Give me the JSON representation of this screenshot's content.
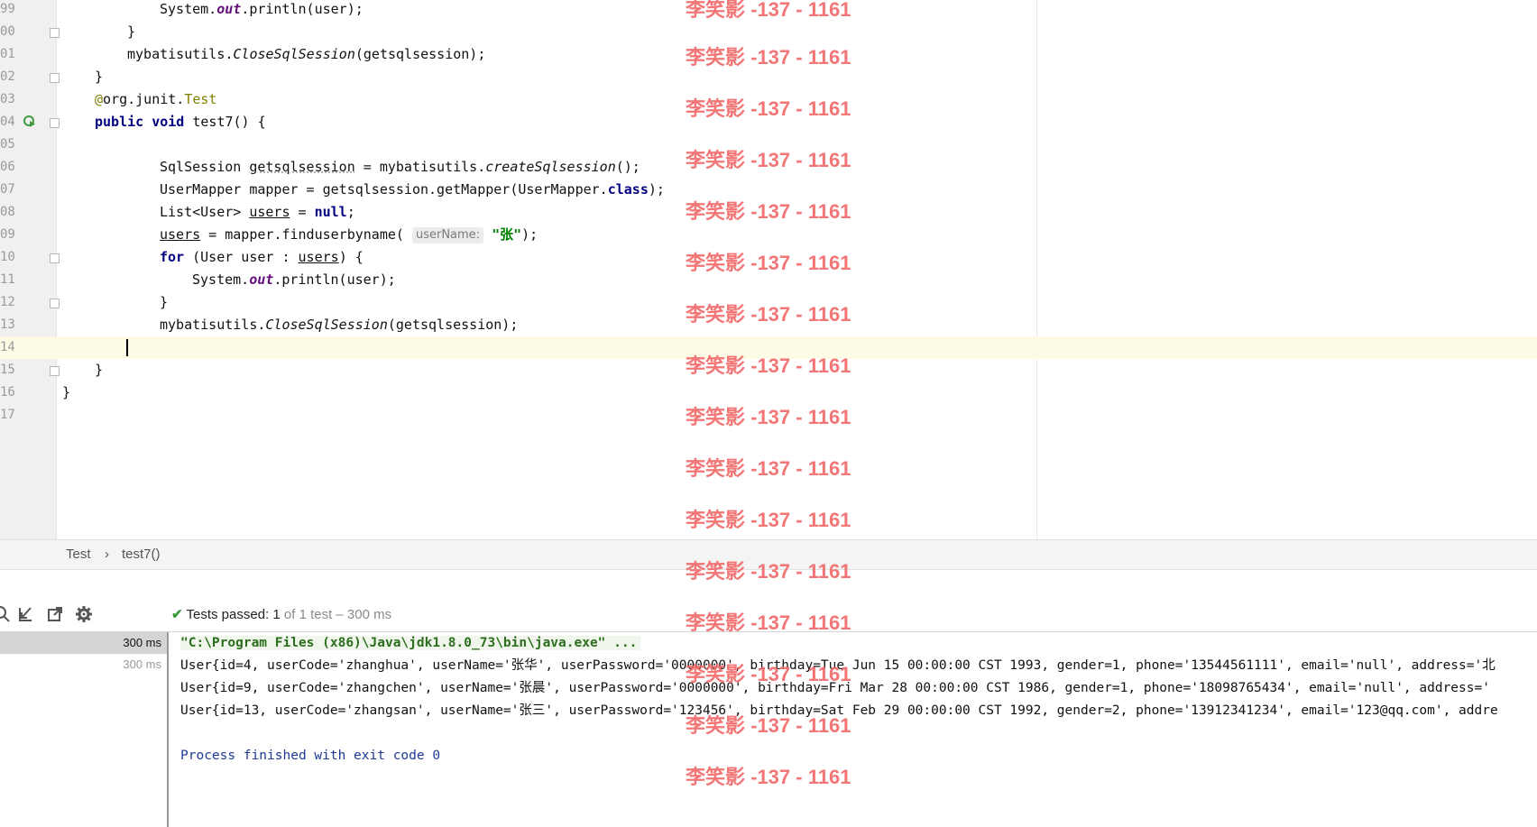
{
  "editor": {
    "lines": [
      {
        "num": "99",
        "html_key": "l99"
      },
      {
        "num": "00",
        "html_key": "l100"
      },
      {
        "num": "01",
        "html_key": "l101"
      },
      {
        "num": "02",
        "html_key": "l102"
      },
      {
        "num": "03",
        "html_key": "l103"
      },
      {
        "num": "04",
        "html_key": "l104"
      },
      {
        "num": "05",
        "html_key": "l105"
      },
      {
        "num": "06",
        "html_key": "l106"
      },
      {
        "num": "07",
        "html_key": "l107"
      },
      {
        "num": "08",
        "html_key": "l108"
      },
      {
        "num": "09",
        "html_key": "l109"
      },
      {
        "num": "10",
        "html_key": "l110"
      },
      {
        "num": "11",
        "html_key": "l111"
      },
      {
        "num": "12",
        "html_key": "l112"
      },
      {
        "num": "13",
        "html_key": "l113"
      },
      {
        "num": "14",
        "html_key": "l114"
      },
      {
        "num": "15",
        "html_key": "l115"
      },
      {
        "num": "16",
        "html_key": "l116"
      },
      {
        "num": "17",
        "html_key": "l117"
      }
    ],
    "tokens": {
      "system": "System.",
      "out": "out",
      "println_user": ".println(user);",
      "close_brace": "}",
      "mybatisutils": "mybatisutils.",
      "close_sql": "CloseSqlSession",
      "close_arg": "(getsqlsession);",
      "at": "@",
      "org_junit": "org.junit.",
      "test_ann": "Test",
      "public": "public",
      "void": "void",
      "test7": "test7() {",
      "sqlsession": "SqlSession ",
      "getsqlsession": "getsqlsession",
      "eq_mybatis": " = mybatisutils.",
      "create_sql": "createSqlsession",
      "create_end": "();",
      "usermapper_line": "UserMapper mapper = getsqlsession.getMapper(UserMapper.",
      "class_kw": "class",
      "close_paren": ");",
      "list_user": "List<User> ",
      "users": "users",
      "eq": " = ",
      "null_kw": "null",
      "semicolon": ";",
      "finduser": " = mapper.finduserbyname(",
      "hint": "userName:",
      "zhang": "\"张\"",
      "for_kw": "for",
      "for_head": " (User user : ",
      "for_tail": ") {",
      "system2": "System.",
      "println2": ".println(user);"
    }
  },
  "breadcrumb": {
    "class_name": "Test",
    "separator": "›",
    "method": "test7()"
  },
  "run": {
    "status_label": "Tests passed:",
    "status_count": "1",
    "status_rest": "of 1 test – 300 ms",
    "tree": [
      {
        "label": "300 ms",
        "selected": true
      },
      {
        "label": "300 ms",
        "selected": false
      }
    ],
    "console": {
      "cmd": "\"C:\\Program Files (x86)\\Java\\jdk1.8.0_73\\bin\\java.exe\" ...",
      "rows": [
        "User{id=4, userCode='zhanghua', userName='张华', userPassword='0000000', birthday=Tue Jun 15 00:00:00 CST 1993, gender=1, phone='13544561111', email='null', address='北",
        "User{id=9, userCode='zhangchen', userName='张晨', userPassword='0000000', birthday=Fri Mar 28 00:00:00 CST 1986, gender=1, phone='18098765434', email='null', address='",
        "User{id=13, userCode='zhangsan', userName='张三', userPassword='123456', birthday=Sat Feb 29 00:00:00 CST 1992, gender=2, phone='13912341234', email='123@qq.com', addre"
      ],
      "exit": "Process finished with exit code 0"
    }
  },
  "watermark": {
    "text": "李笑影 -137 - 1161",
    "color": "#f16b6b"
  }
}
